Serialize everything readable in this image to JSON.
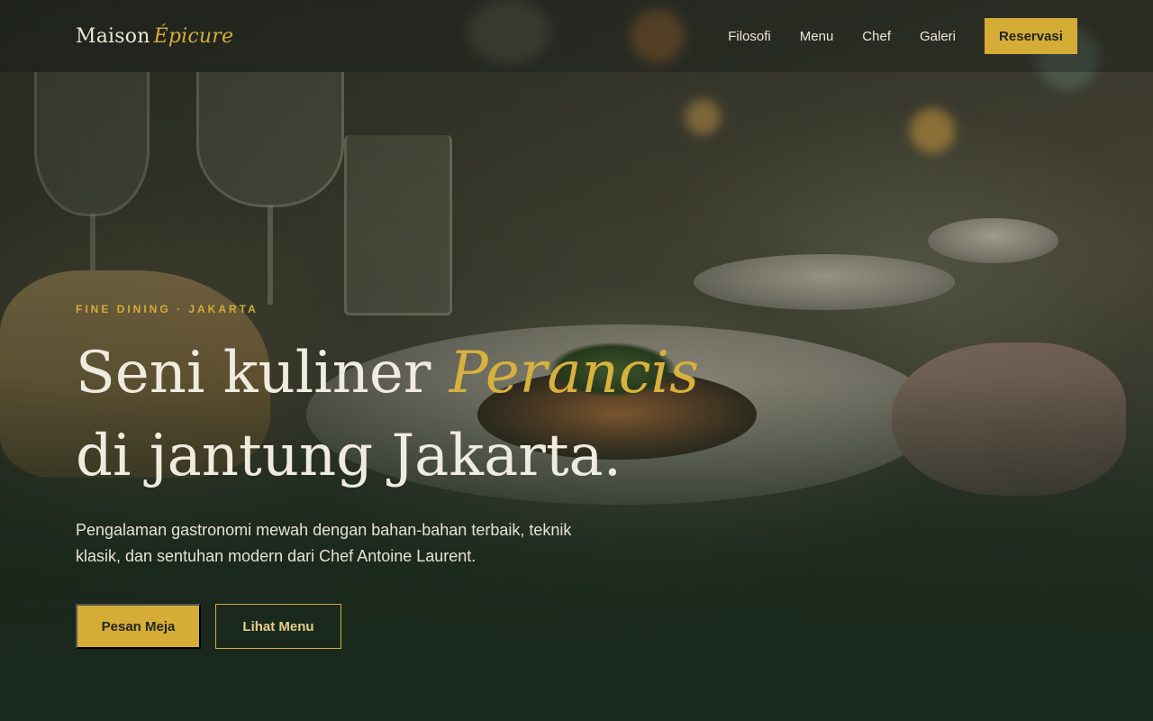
{
  "header": {
    "logo_main": "Maison",
    "logo_accent": "Épicure",
    "nav": [
      {
        "label": "Filosofi"
      },
      {
        "label": "Menu"
      },
      {
        "label": "Chef"
      },
      {
        "label": "Galeri"
      }
    ],
    "cta_label": "Reservasi"
  },
  "hero": {
    "eyebrow": "FINE DINING · JAKARTA",
    "headline_part1": "Seni kuliner ",
    "headline_accent": "Perancis",
    "headline_part2": " di jantung Jakarta.",
    "subtext": "Pengalaman gastronomi mewah dengan bahan-bahan terbaik, teknik klasik, dan sentuhan modern dari Chef Antoine Laurent.",
    "primary_button": "Pesan Meja",
    "secondary_button": "Lihat Menu"
  },
  "colors": {
    "accent": "#d4ac36",
    "background": "#1e2a20",
    "text_light": "#f0ebdf"
  }
}
